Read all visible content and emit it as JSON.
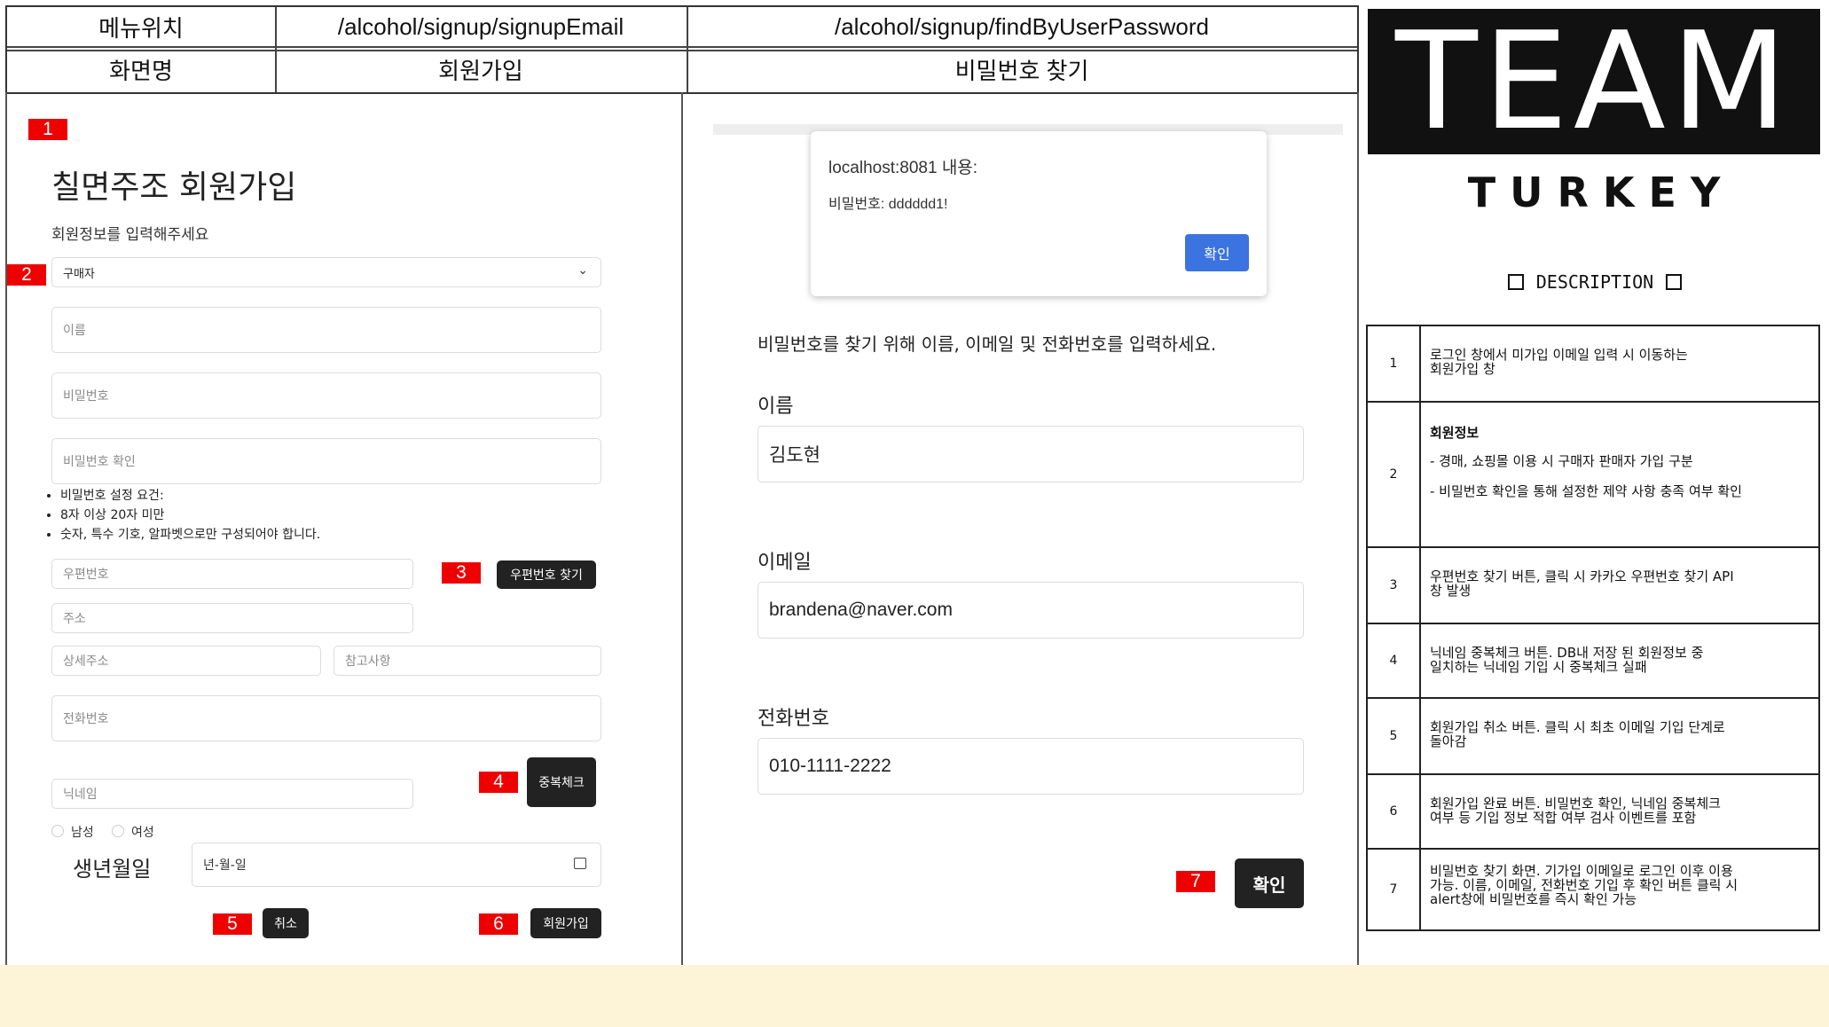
{
  "header": {
    "menu_location_label": "메뉴위치",
    "screen_name_label": "화면명",
    "signup_path": "/alcohol/signup/signupEmail",
    "find_path": "/alcohol/signup/findByUserPassword",
    "signup_screen": "회원가입",
    "find_screen": "비밀번호 찾기"
  },
  "signup": {
    "title": "칠면주조 회원가입",
    "subtitle": "회원정보를 입력해주세요",
    "role_selected": "구매자",
    "name_placeholder": "이름",
    "password_placeholder": "비밀번호",
    "password_confirm_placeholder": "비밀번호 확인",
    "rules": [
      "비밀번호 설정 요건:",
      "8자 이상 20자 미만",
      "숫자, 특수 기호, 알파벳으로만 구성되어야 합니다."
    ],
    "postcode_placeholder": "우편번호",
    "postcode_button": "우편번호 찾기",
    "address_placeholder": "주소",
    "detail_address_placeholder": "상세주소",
    "extra_address_placeholder": "참고사항",
    "phone_placeholder": "전화번호",
    "nickname_placeholder": "닉네임",
    "duplicate_button": "중복체크",
    "gender_male": "남성",
    "gender_female": "여성",
    "birth_label": "생년월일",
    "birth_placeholder": "년-월-일",
    "cancel_button": "취소",
    "submit_button": "회원가입"
  },
  "find": {
    "alert_origin": "localhost:8081 내용:",
    "alert_message": "비밀번호: dddddd1!",
    "alert_ok": "확인",
    "instruction": "비밀번호를 찾기 위해 이름, 이메일 및 전화번호를 입력하세요.",
    "name_label": "이름",
    "name_value": "김도현",
    "email_label": "이메일",
    "email_value": "brandena@naver.com",
    "phone_label": "전화번호",
    "phone_value": "010-1111-2222",
    "confirm_button": "확인"
  },
  "tags": [
    "1",
    "2",
    "3",
    "4",
    "5",
    "6",
    "7"
  ],
  "logo": {
    "team": "TEAM",
    "sub": "T U R K E Y"
  },
  "description": {
    "heading": "DESCRIPTION",
    "rows": [
      {
        "num": "1",
        "lines": [
          "로그인 창에서 미가입 이메일 입력 시 이동하는",
          "회원가입 창"
        ]
      },
      {
        "num": "2",
        "title": "회원정보",
        "lines": [
          "- 경매, 쇼핑몰 이용 시 구매자 판매자 가입 구분",
          "- 비밀번호 확인을 통해 설정한 제약 사항 충족 여부 확인"
        ]
      },
      {
        "num": "3",
        "lines": [
          "우편번호 찾기 버튼, 클릭 시 카카오 우편번호 찾기 API",
          "창 발생"
        ]
      },
      {
        "num": "4",
        "lines": [
          "닉네임 중복체크 버튼. DB내 저장 된 회원정보 중",
          "일치하는 닉네임 기입 시 중복체크 실패"
        ]
      },
      {
        "num": "5",
        "lines": [
          "회원가입 취소 버튼. 클릭 시 최초 이메일 기입 단계로",
          "돌아감"
        ]
      },
      {
        "num": "6",
        "lines": [
          "회원가입 완료 버튼. 비밀번호 확인, 닉네임 중복체크",
          "여부 등 기입 정보 적합 여부 검사 이벤트를 포함"
        ]
      },
      {
        "num": "7",
        "lines": [
          "비밀번호 찾기 화면. 기가입 이메일로 로그인 이후 이용",
          "가능. 이름, 이메일, 전화번호 기입 후 확인 버튼 클릭 시",
          "alert창에 비밀번호를 즉시 확인 가능"
        ]
      }
    ]
  },
  "colors": {
    "tag_red": "#ee0000",
    "alert_blue": "#3b73e0",
    "band": "#fdf3d6",
    "logo_black": "#111111"
  }
}
